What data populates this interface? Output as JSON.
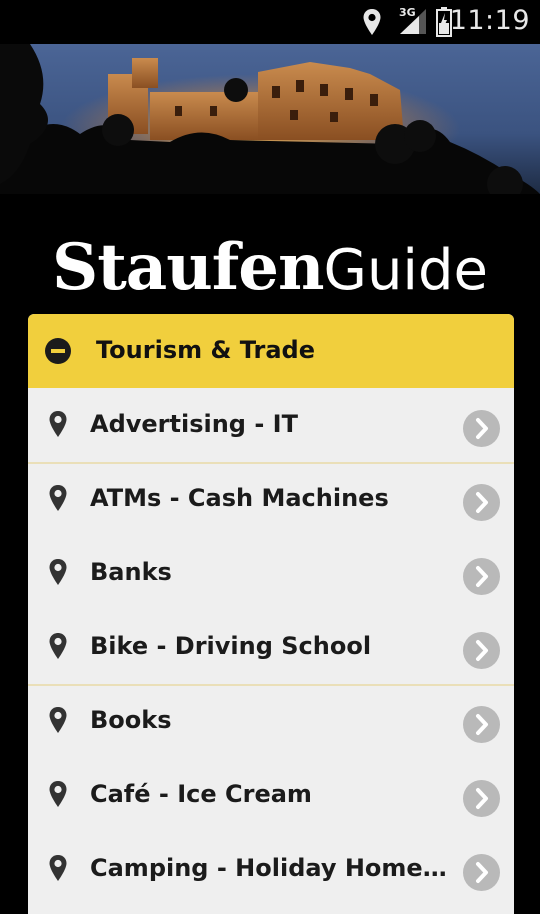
{
  "status_bar": {
    "network": "3G",
    "time": "11:19",
    "icons": [
      "location-icon",
      "signal-icon",
      "battery-icon"
    ]
  },
  "header": {
    "title_part1": "Staufen",
    "title_part2": "Guide"
  },
  "category": {
    "label": "Tourism & Trade",
    "icon": "collapse-minus-icon",
    "accent_color": "#f1cf3d"
  },
  "items": [
    {
      "label": "Advertising - IT"
    },
    {
      "label": "ATMs - Cash Machines"
    },
    {
      "label": "Banks"
    },
    {
      "label": "Bike - Driving School"
    },
    {
      "label": "Books"
    },
    {
      "label": "Café - Ice Cream"
    },
    {
      "label": "Camping - Holiday Homes -…"
    }
  ]
}
